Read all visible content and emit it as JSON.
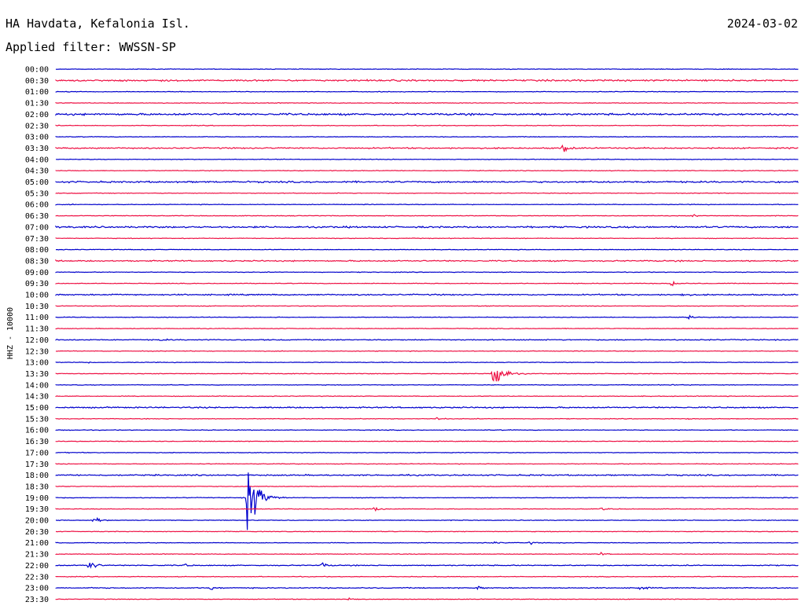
{
  "header": {
    "station": "HA Havdata, Kefalonia Isl.",
    "date": "2024-03-02",
    "filter": "Applied filter: WWSSN-SP"
  },
  "chart_data": {
    "type": "line",
    "title": "HA Havdata, Kefalonia Isl.",
    "ylabel": "HHZ - 10000",
    "xlabel": "",
    "trace_minutes": 30,
    "colors": {
      "even": "#0000cc",
      "odd": "#ee1144"
    },
    "rows": [
      "00:00",
      "00:30",
      "01:00",
      "01:30",
      "02:00",
      "02:30",
      "03:00",
      "03:30",
      "04:00",
      "04:30",
      "05:00",
      "05:30",
      "06:00",
      "06:30",
      "07:00",
      "07:30",
      "08:00",
      "08:30",
      "09:00",
      "09:30",
      "10:00",
      "10:30",
      "11:00",
      "11:30",
      "12:00",
      "12:30",
      "13:00",
      "13:30",
      "14:00",
      "14:30",
      "15:00",
      "15:30",
      "16:00",
      "16:30",
      "17:00",
      "17:30",
      "18:00",
      "18:30",
      "19:00",
      "19:30",
      "20:00",
      "20:30",
      "21:00",
      "21:30",
      "22:00",
      "22:30",
      "23:00",
      "23:30"
    ],
    "noise_levels": [
      1,
      2.5,
      1,
      1,
      3,
      1,
      1,
      2,
      1,
      1,
      2.5,
      1,
      1,
      1,
      2.5,
      1,
      1,
      2,
      1,
      1,
      2,
      1,
      1,
      1,
      1.5,
      1,
      1,
      1,
      1,
      1,
      2,
      1,
      1,
      1,
      1,
      1,
      2,
      1,
      1,
      1,
      1,
      1,
      1,
      1,
      1.5,
      1,
      1.5,
      1
    ],
    "events": [
      {
        "row": 1,
        "minute": 13.5,
        "amp": 1
      },
      {
        "row": 3,
        "minute": 13.6,
        "amp": 2
      },
      {
        "row": 7,
        "minute": 20.4,
        "amp": 25
      },
      {
        "row": 11,
        "minute": 26.5,
        "amp": 1.5
      },
      {
        "row": 12,
        "minute": 0.5,
        "amp": 1
      },
      {
        "row": 13,
        "minute": 25.7,
        "amp": 5
      },
      {
        "row": 19,
        "minute": 24.8,
        "amp": 18
      },
      {
        "row": 20,
        "minute": 2.4,
        "amp": 6
      },
      {
        "row": 20,
        "minute": 25.2,
        "amp": 6
      },
      {
        "row": 22,
        "minute": 4.2,
        "amp": 1.5
      },
      {
        "row": 22,
        "minute": 25.5,
        "amp": 6
      },
      {
        "row": 24,
        "minute": 4.2,
        "amp": 4
      },
      {
        "row": 26,
        "minute": 1.3,
        "amp": 2
      },
      {
        "row": 27,
        "minute": 17.6,
        "amp": 80
      },
      {
        "row": 28,
        "minute": 24.8,
        "amp": 3
      },
      {
        "row": 31,
        "minute": 15.3,
        "amp": 6
      },
      {
        "row": 31,
        "minute": 25.5,
        "amp": 2
      },
      {
        "row": 32,
        "minute": 0.2,
        "amp": 3
      },
      {
        "row": 34,
        "minute": 0.5,
        "amp": 2
      },
      {
        "row": 38,
        "minute": 7.7,
        "amp": 180
      },
      {
        "row": 39,
        "minute": 12.8,
        "amp": 12
      },
      {
        "row": 39,
        "minute": 22.0,
        "amp": 6
      },
      {
        "row": 40,
        "minute": 1.5,
        "amp": 25
      },
      {
        "row": 42,
        "minute": 17.6,
        "amp": 6
      },
      {
        "row": 42,
        "minute": 19.1,
        "amp": 6
      },
      {
        "row": 43,
        "minute": 21.9,
        "amp": 8
      },
      {
        "row": 44,
        "minute": 1.3,
        "amp": 40
      },
      {
        "row": 44,
        "minute": 5.1,
        "amp": 8
      },
      {
        "row": 44,
        "minute": 10.7,
        "amp": 12
      },
      {
        "row": 46,
        "minute": 6.2,
        "amp": 10
      },
      {
        "row": 46,
        "minute": 17.0,
        "amp": 8
      },
      {
        "row": 46,
        "minute": 23.5,
        "amp": 10
      },
      {
        "row": 47,
        "minute": 11.8,
        "amp": 12
      }
    ]
  }
}
